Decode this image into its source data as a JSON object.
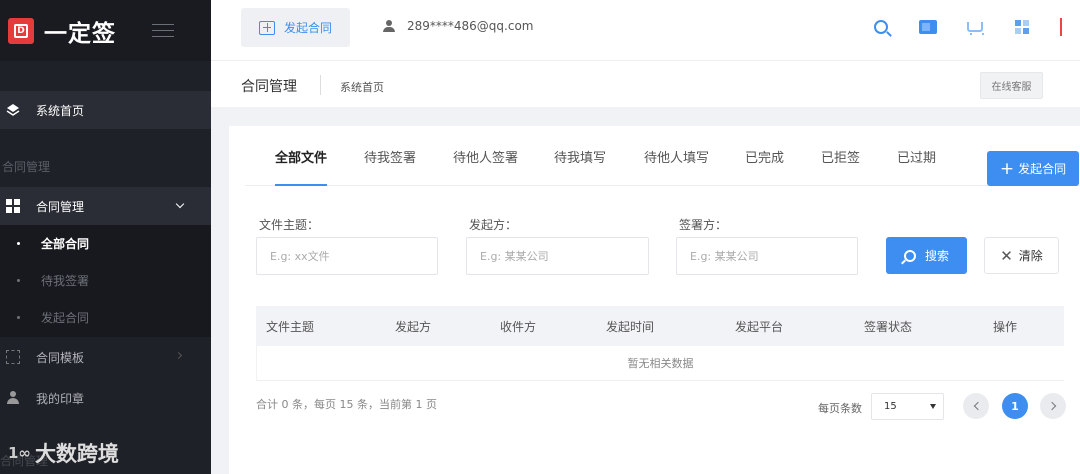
{
  "app": {
    "logo_text": "一定签",
    "logo_glyph": "D"
  },
  "sidebar": {
    "home": "系统首页",
    "group_label": "合同管理",
    "contract_mgmt": "合同管理",
    "submenu": [
      "全部合同",
      "待我签署",
      "发起合同"
    ],
    "template": "合同模板",
    "seal": "我的印章",
    "group_label_2": "合同管理"
  },
  "watermark": {
    "logo": "1∞",
    "text": "大数跨境"
  },
  "topbar": {
    "start_contract": "发起合同",
    "user_email": "289****486@qq.com",
    "icons": [
      "search-icon",
      "message-icon",
      "cart-icon",
      "apps-icon"
    ]
  },
  "breadcrumb": {
    "title": "合同管理",
    "sub": "系统首页",
    "service": "在线客服"
  },
  "tabs": [
    "全部文件",
    "待我签署",
    "待他人签署",
    "待我填写",
    "待他人填写",
    "已完成",
    "已拒签",
    "已过期"
  ],
  "new_contract_button": "发起合同",
  "filters": {
    "subject_label": "文件主题：",
    "subject_placeholder": "E.g: xx文件",
    "sender_label": "发起方：",
    "sender_placeholder": "E.g: 某某公司",
    "signer_label": "签署方：",
    "signer_placeholder": "E.g: 某某公司",
    "search": "搜索",
    "clear": "清除"
  },
  "table": {
    "columns": [
      "文件主题",
      "发起方",
      "收件方",
      "发起时间",
      "发起平台",
      "签署状态",
      "操作"
    ],
    "empty": "暂无相关数据"
  },
  "pagination": {
    "summary": "合计 0 条，每页 15 条，当前第 1 页",
    "per_page_label": "每页条数",
    "per_page": "15",
    "current": "1"
  },
  "colors": {
    "accent": "#3d8ef0",
    "sidebar": "#1f2128",
    "brand_red": "#e43c3c"
  }
}
